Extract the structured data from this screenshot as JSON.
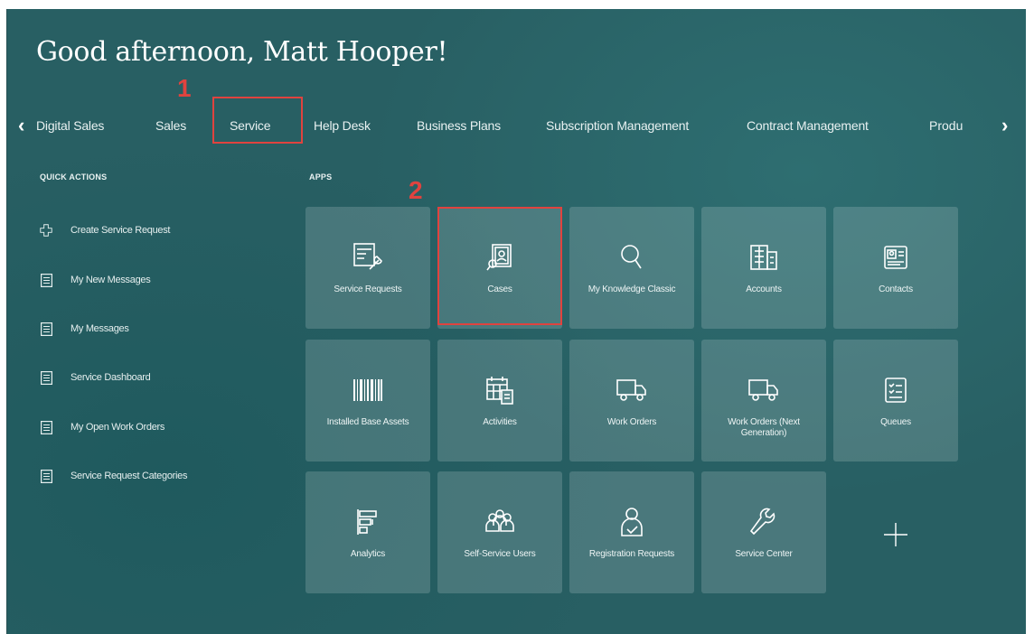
{
  "greeting": "Good afternoon, Matt Hooper!",
  "nav": {
    "prev_icon": "chevron-left-icon",
    "next_icon": "chevron-right-icon",
    "tabs": [
      "Digital Sales",
      "Sales",
      "Service",
      "Help Desk",
      "Business Plans",
      "Subscription Management",
      "Contract Management",
      "Produ"
    ],
    "selected": "Service"
  },
  "annotations": {
    "step1": "1",
    "step2": "2",
    "color": "#e0433f"
  },
  "quick_actions": {
    "heading": "QUICK ACTIONS",
    "items": [
      {
        "label": "Create Service Request",
        "icon": "create-request-icon"
      },
      {
        "label": "My New Messages",
        "icon": "document-icon"
      },
      {
        "label": "My Messages",
        "icon": "document-icon"
      },
      {
        "label": "Service Dashboard",
        "icon": "document-icon"
      },
      {
        "label": "My Open Work Orders",
        "icon": "document-icon"
      },
      {
        "label": "Service Request Categories",
        "icon": "document-icon"
      }
    ]
  },
  "apps": {
    "heading": "APPS",
    "tiles": [
      {
        "label": "Service Requests",
        "icon": "service-requests-icon"
      },
      {
        "label": "Cases",
        "icon": "cases-icon"
      },
      {
        "label": "My Knowledge Classic",
        "icon": "search-icon"
      },
      {
        "label": "Accounts",
        "icon": "building-icon"
      },
      {
        "label": "Contacts",
        "icon": "contact-card-icon"
      },
      {
        "label": "Installed Base Assets",
        "icon": "barcode-icon"
      },
      {
        "label": "Activities",
        "icon": "calendar-icon"
      },
      {
        "label": "Work Orders",
        "icon": "truck-icon"
      },
      {
        "label": "Work Orders (Next Generation)",
        "icon": "truck-icon"
      },
      {
        "label": "Queues",
        "icon": "checklist-icon"
      },
      {
        "label": "Analytics",
        "icon": "analytics-icon"
      },
      {
        "label": "Self-Service Users",
        "icon": "users-icon"
      },
      {
        "label": "Registration Requests",
        "icon": "user-check-icon"
      },
      {
        "label": "Service Center",
        "icon": "wrench-icon"
      },
      {
        "label": "",
        "icon": "plus-icon"
      }
    ]
  },
  "colors": {
    "background": "#285f63",
    "tile": "#5a8a8d",
    "text": "#ffffff"
  }
}
